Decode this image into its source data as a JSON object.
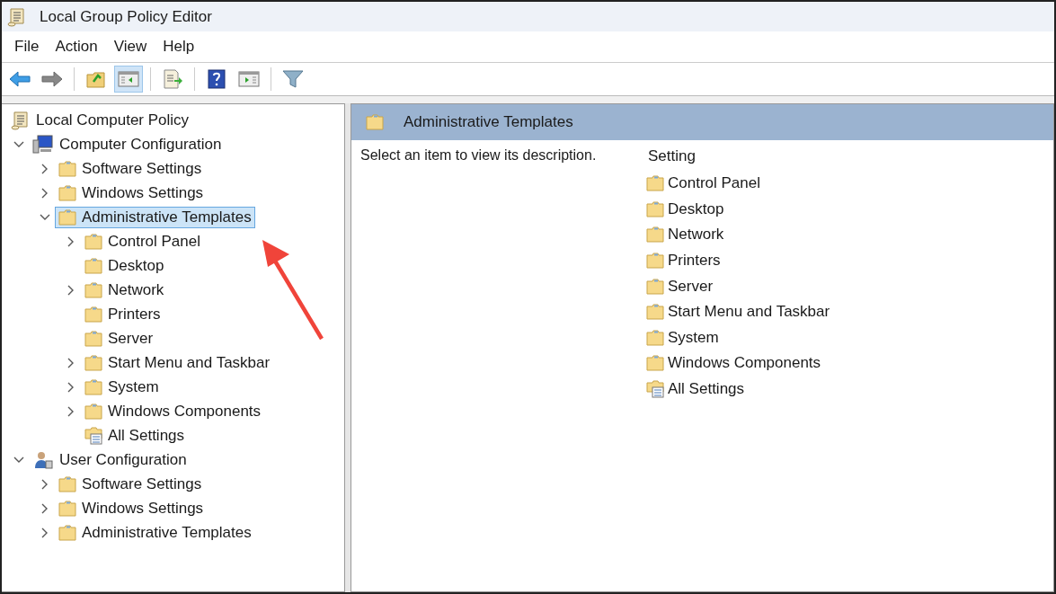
{
  "window": {
    "title": "Local Group Policy Editor"
  },
  "menu": [
    "File",
    "Action",
    "View",
    "Help"
  ],
  "toolbar": [
    {
      "kind": "back",
      "pressed": false
    },
    {
      "kind": "forward",
      "pressed": false
    },
    {
      "kind": "up",
      "pressed": false
    },
    {
      "kind": "tree",
      "pressed": true
    },
    {
      "kind": "export",
      "pressed": false
    },
    {
      "kind": "help",
      "pressed": false
    },
    {
      "kind": "pane",
      "pressed": false
    },
    {
      "kind": "filter",
      "pressed": false
    }
  ],
  "tree": [
    {
      "label": "Local Computer Policy",
      "kind": "scroll",
      "selected": false,
      "children": [
        {
          "label": "Computer Configuration",
          "kind": "computer",
          "expanded": true,
          "selected": false,
          "children": [
            {
              "label": "Software Settings",
              "kind": "folder",
              "expanded": false,
              "selected": false
            },
            {
              "label": "Windows Settings",
              "kind": "folder",
              "expanded": false,
              "selected": false
            },
            {
              "label": "Administrative Templates",
              "kind": "folder",
              "expanded": true,
              "selected": true,
              "children": [
                {
                  "label": "Control Panel",
                  "kind": "folder",
                  "expanded": false,
                  "selected": false
                },
                {
                  "label": "Desktop",
                  "kind": "folder",
                  "selected": false
                },
                {
                  "label": "Network",
                  "kind": "folder",
                  "expanded": false,
                  "selected": false
                },
                {
                  "label": "Printers",
                  "kind": "folder",
                  "selected": false
                },
                {
                  "label": "Server",
                  "kind": "folder",
                  "selected": false
                },
                {
                  "label": "Start Menu and Taskbar",
                  "kind": "folder",
                  "expanded": false,
                  "selected": false
                },
                {
                  "label": "System",
                  "kind": "folder",
                  "expanded": false,
                  "selected": false
                },
                {
                  "label": "Windows Components",
                  "kind": "folder",
                  "expanded": false,
                  "selected": false
                },
                {
                  "label": "All Settings",
                  "kind": "settings",
                  "selected": false
                }
              ]
            }
          ]
        },
        {
          "label": "User Configuration",
          "kind": "user",
          "expanded": true,
          "selected": false,
          "children": [
            {
              "label": "Software Settings",
              "kind": "folder",
              "expanded": false,
              "selected": false
            },
            {
              "label": "Windows Settings",
              "kind": "folder",
              "expanded": false,
              "selected": false
            },
            {
              "label": "Administrative Templates",
              "kind": "folder",
              "expanded": false,
              "selected": false
            }
          ]
        }
      ]
    }
  ],
  "details": {
    "title": "Administrative Templates",
    "description": "Select an item to view its description.",
    "column": "Setting",
    "items": [
      {
        "label": "Control Panel",
        "kind": "folder"
      },
      {
        "label": "Desktop",
        "kind": "folder"
      },
      {
        "label": "Network",
        "kind": "folder"
      },
      {
        "label": "Printers",
        "kind": "folder"
      },
      {
        "label": "Server",
        "kind": "folder"
      },
      {
        "label": "Start Menu and Taskbar",
        "kind": "folder"
      },
      {
        "label": "System",
        "kind": "folder"
      },
      {
        "label": "Windows Components",
        "kind": "folder"
      },
      {
        "label": "All Settings",
        "kind": "settings"
      }
    ]
  }
}
